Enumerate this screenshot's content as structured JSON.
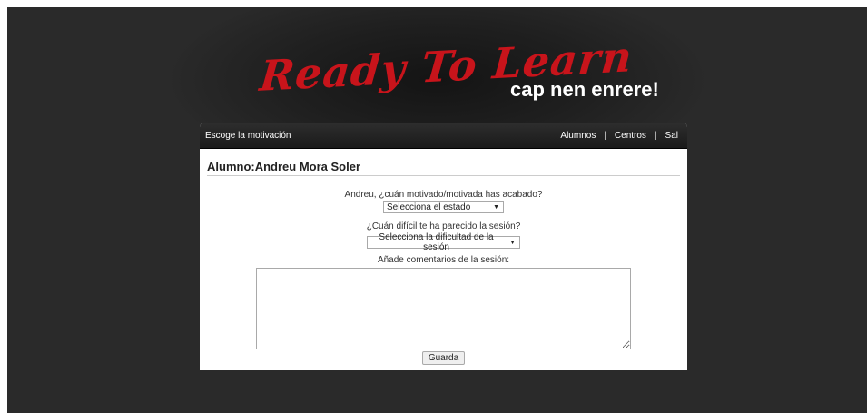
{
  "brand": {
    "logo_main": "Ready To Learn",
    "logo_sub": "cap nen enrere!",
    "logo_color": "#c8141b"
  },
  "topbar": {
    "title": "Escoge la motivación",
    "nav": [
      "Alumnos",
      "Centros",
      "Sal"
    ],
    "separator": "|"
  },
  "student": {
    "label": "Alumno:",
    "name": "Andreu Mora Soler"
  },
  "form": {
    "motivation_question": "Andreu, ¿cuán motivado/motivada has acabado?",
    "motivation_selected": "Selecciona el estado",
    "difficulty_question": "¿Cuán difícil te ha parecido la sesión?",
    "difficulty_selected": "Selecciona la dificultad de la sesión",
    "comments_label": "Añade comentarios de la sesión:",
    "comments_value": "",
    "save_label": "Guarda"
  }
}
